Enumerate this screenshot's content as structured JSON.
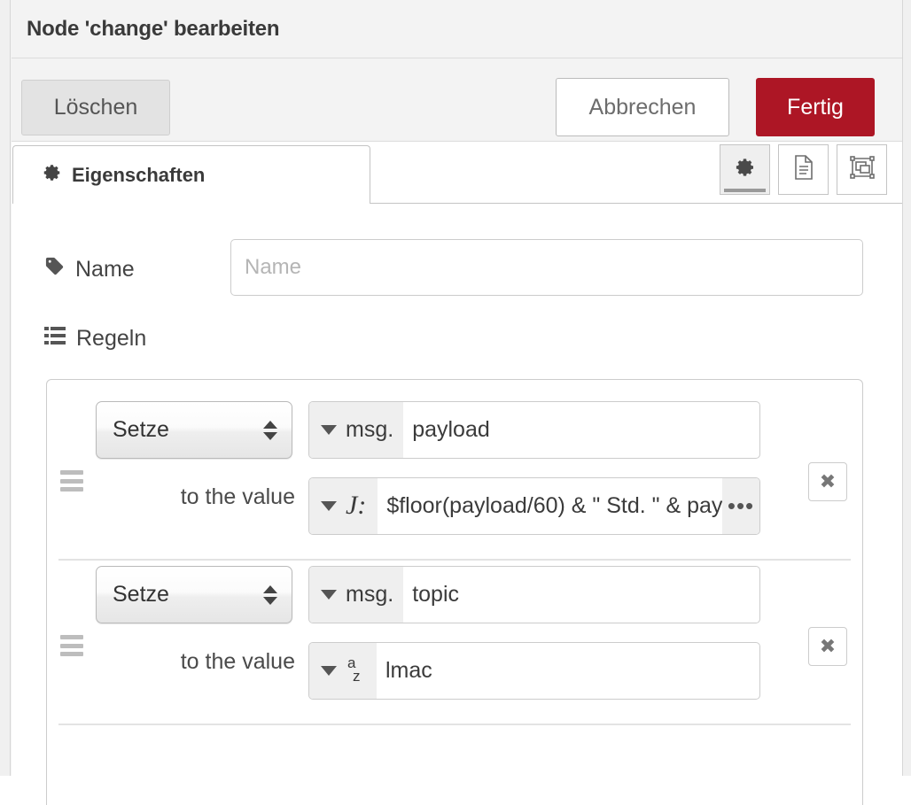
{
  "dialog": {
    "title": "Node 'change' bearbeiten"
  },
  "actions": {
    "delete_label": "Löschen",
    "cancel_label": "Abbrechen",
    "done_label": "Fertig",
    "done_color": "#ad1625"
  },
  "tabs": {
    "items": [
      {
        "label": "Eigenschaften",
        "icon": "gear-icon",
        "active": true
      }
    ],
    "icon_buttons": [
      {
        "name": "properties-gear-icon",
        "active": true
      },
      {
        "name": "description-document-icon",
        "active": false
      },
      {
        "name": "appearance-objectgroup-icon",
        "active": false
      }
    ]
  },
  "form": {
    "name": {
      "label": "Name",
      "icon": "tag-icon",
      "value": "",
      "placeholder": "Name"
    },
    "rules": {
      "label": "Regeln",
      "icon": "list-icon",
      "to_value_label": "to the value",
      "remove_label": "✖",
      "expand_label": "•••",
      "items": [
        {
          "action": "Setze",
          "target": {
            "prefix": "msg.",
            "prefix_icon": "chevron-down-icon",
            "value": "payload"
          },
          "value": {
            "type_icon": "jsonata-icon",
            "type_glyph": "J:",
            "prefix_icon": "chevron-down-icon",
            "value": "$floor(payload/60) & \" Std. \" & pay",
            "has_expand": true
          }
        },
        {
          "action": "Setze",
          "target": {
            "prefix": "msg.",
            "prefix_icon": "chevron-down-icon",
            "value": "topic"
          },
          "value": {
            "type_icon": "string-az-icon",
            "type_glyph_top": "a",
            "type_glyph_bottom": "z",
            "prefix_icon": "chevron-down-icon",
            "value": "lmac",
            "has_expand": false
          }
        }
      ]
    }
  }
}
